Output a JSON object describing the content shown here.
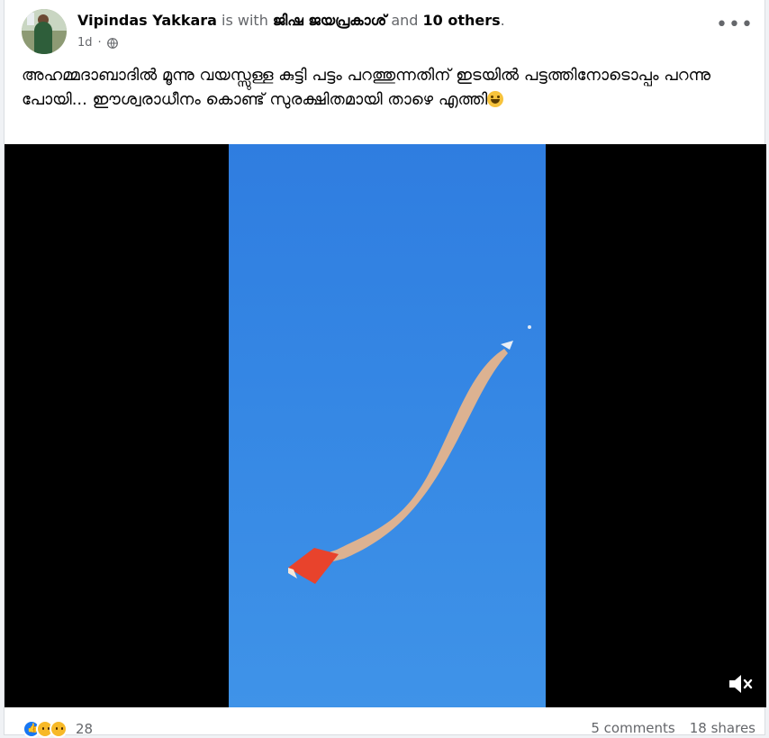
{
  "post": {
    "author": "Vipindas Yakkara",
    "with_text": " is with ",
    "tagged_name": "ജിഷ ജയപ്രകാശ്",
    "and_text": " and ",
    "others": "10 others",
    "period": ".",
    "time": "1d",
    "privacy_icon": "globe-icon",
    "more_icon": "more-icon",
    "caption": "അഹമ്മദാബാദിൽ മൂന്നു വയസ്സുള്ള കുട്ടി പട്ടം പറത്തുന്നതിന് ഇടയിൽ പട്ടത്തിനോടൊപ്പം പറന്നു പോയി... ഈശ്വരാധീനം കൊണ്ട് സുരക്ഷിതമായി താഴെ എത്തി",
    "caption_emoji": "grinning-face-emoji"
  },
  "video": {
    "mute_icon": "muted-speaker-icon",
    "sky_color": "#3587e4"
  },
  "footer": {
    "reaction_icons": [
      "like-icon",
      "wow-icon",
      "sad-icon"
    ],
    "reaction_count": "28",
    "comments": "5 comments",
    "shares": "18 shares"
  },
  "colors": {
    "text": "#050505",
    "secondary": "#65676b",
    "accent": "#1877f2"
  }
}
